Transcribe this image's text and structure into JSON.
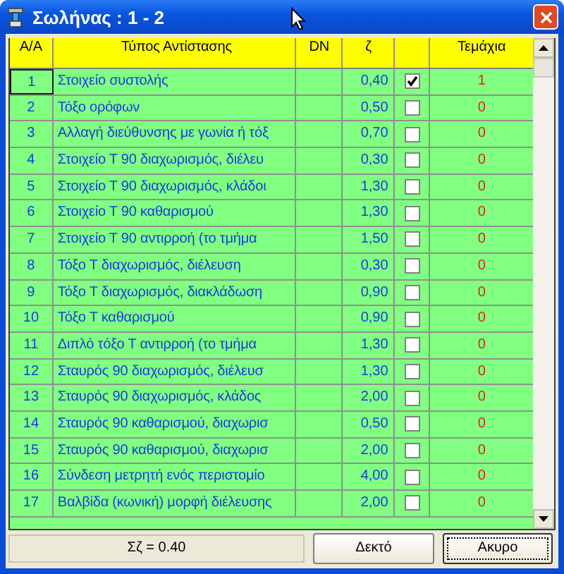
{
  "window": {
    "title": "Σωλήνας : 1 - 2"
  },
  "table": {
    "columns": [
      "A/A",
      "Τύπος Αντίστασης",
      "DN",
      "ζ",
      "Τεμάχια"
    ],
    "rows": [
      {
        "aa": "1",
        "type": "Στοιχείο συστολής",
        "zeta": "0,40",
        "checked": true,
        "count": "1",
        "selected": true
      },
      {
        "aa": "2",
        "type": "Τόξο ορόφων",
        "zeta": "0,50",
        "checked": false,
        "count": "0",
        "selected": false
      },
      {
        "aa": "3",
        "type": "Αλλαγή διεύθυνσης με γωνία ή τόξ",
        "zeta": "0,70",
        "checked": false,
        "count": "0",
        "selected": false
      },
      {
        "aa": "4",
        "type": "Στοιχείο Τ 90 διαχωρισμός, διέλευ",
        "zeta": "0,30",
        "checked": false,
        "count": "0",
        "selected": false
      },
      {
        "aa": "5",
        "type": "Στοιχείο Τ 90 διαχωρισμός, κλάδοι",
        "zeta": "1,30",
        "checked": false,
        "count": "0",
        "selected": false
      },
      {
        "aa": "6",
        "type": "Στοιχείο Τ 90 καθαρισμού",
        "zeta": "1,30",
        "checked": false,
        "count": "0",
        "selected": false
      },
      {
        "aa": "7",
        "type": "Στοιχείο Τ 90 αντιρροή (το τμήμα",
        "zeta": "1,50",
        "checked": false,
        "count": "0",
        "selected": false
      },
      {
        "aa": "8",
        "type": "Τόξο Τ διαχωρισμός, διέλευση",
        "zeta": "0,30",
        "checked": false,
        "count": "0",
        "selected": false
      },
      {
        "aa": "9",
        "type": "Τόξο Τ διαχωρισμός, διακλάδωση",
        "zeta": "0,90",
        "checked": false,
        "count": "0",
        "selected": false
      },
      {
        "aa": "10",
        "type": "Τόξο Τ καθαρισμού",
        "zeta": "0,90",
        "checked": false,
        "count": "0",
        "selected": false
      },
      {
        "aa": "11",
        "type": "Διπλό τόξο Τ αντιρροή (το τμήμα",
        "zeta": "1,30",
        "checked": false,
        "count": "0",
        "selected": false
      },
      {
        "aa": "12",
        "type": "Σταυρός 90 διαχωρισμός, διέλευσ",
        "zeta": "1,30",
        "checked": false,
        "count": "0",
        "selected": false
      },
      {
        "aa": "13",
        "type": "Σταυρός 90 διαχωρισμός, κλάδος",
        "zeta": "2,00",
        "checked": false,
        "count": "0",
        "selected": false
      },
      {
        "aa": "14",
        "type": "Σταυρός 90 καθαρισμού, διαχωρισ",
        "zeta": "0,50",
        "checked": false,
        "count": "0",
        "selected": false
      },
      {
        "aa": "15",
        "type": "Σταυρός 90 καθαρισμού, διαχωρισ",
        "zeta": "2,00",
        "checked": false,
        "count": "0",
        "selected": false
      },
      {
        "aa": "16",
        "type": "Σύνδεση μετρητή ενός περιστομίο",
        "zeta": "4,00",
        "checked": false,
        "count": "0",
        "selected": false
      },
      {
        "aa": "17",
        "type": "Βαλβίδα (κωνική) μορφή διέλευσης",
        "zeta": "2,00",
        "checked": false,
        "count": "0",
        "selected": false
      }
    ]
  },
  "status": "Σζ = 0.40",
  "buttons": [
    {
      "label": "Δεκτό",
      "focused": false
    },
    {
      "label": "Ακυρο",
      "focused": true
    }
  ]
}
